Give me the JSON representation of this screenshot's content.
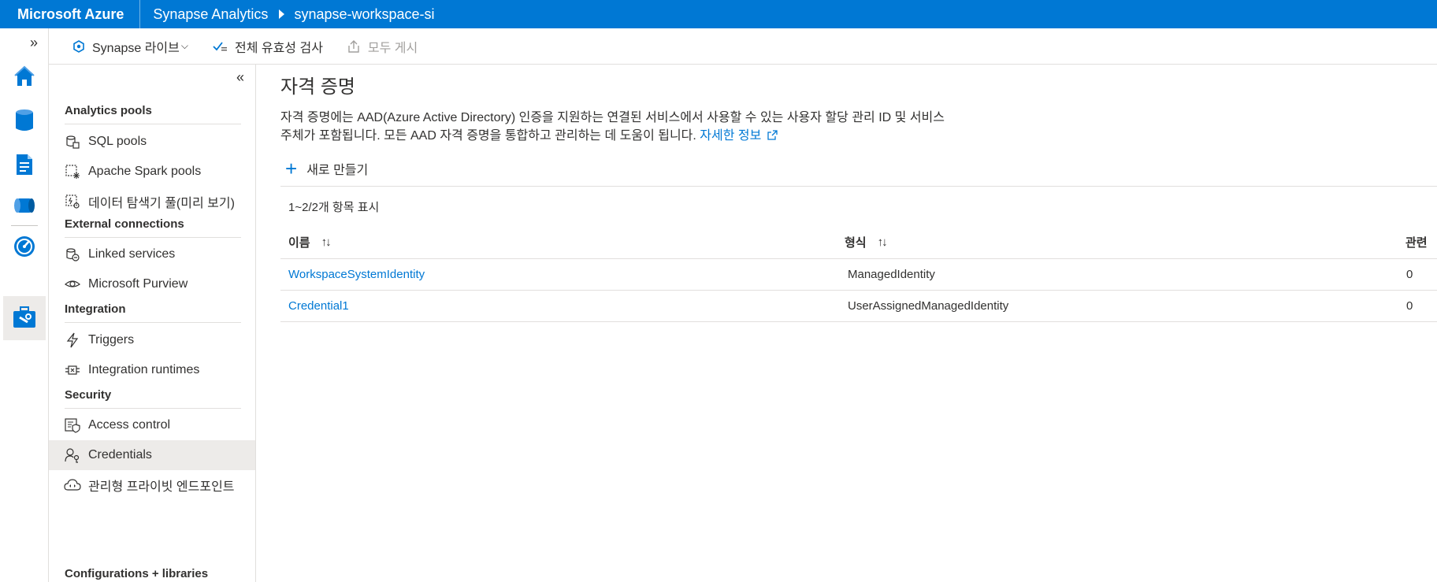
{
  "header": {
    "brand": "Microsoft Azure",
    "breadcrumb": [
      "Synapse Analytics",
      "synapse-workspace-si"
    ]
  },
  "commandbar": {
    "synapse_live": "Synapse 라이브",
    "validate_all": "전체 유효성 검사",
    "publish_all": "모두 게시"
  },
  "nav": {
    "sections": [
      {
        "title": "Analytics pools",
        "items": [
          "SQL pools",
          "Apache Spark pools",
          "데이터 탐색기 풀(미리 보기)"
        ]
      },
      {
        "title": "External connections",
        "items": [
          "Linked services",
          "Microsoft Purview"
        ]
      },
      {
        "title": "Integration",
        "items": [
          "Triggers",
          "Integration runtimes"
        ]
      },
      {
        "title": "Security",
        "items": [
          "Access control",
          "Credentials",
          "관리형 프라이빗 엔드포인트"
        ]
      },
      {
        "title": "Configurations + libraries",
        "items": []
      }
    ],
    "selected": "Credentials"
  },
  "main": {
    "title": "자격 증명",
    "description_line1": "자격 증명에는 AAD(Azure Active Directory) 인증을 지원하는 연결된 서비스에서 사용할 수 있는 사용자 할당 관리 ID 및 서비스",
    "description_line2": "주체가 포함됩니다. 모든 AAD 자격 증명을 통합하고 관리하는 데 도움이 됩니다.",
    "learn_more": "자세한 정보",
    "new_button": "새로 만들기",
    "count_text": "1~2/2개 항목 표시",
    "columns": [
      "이름",
      "형식",
      "관련"
    ],
    "rows": [
      {
        "name": "WorkspaceSystemIdentity",
        "type": "ManagedIdentity",
        "related": "0"
      },
      {
        "name": "Credential1",
        "type": "UserAssignedManagedIdentity",
        "related": "0"
      }
    ]
  }
}
